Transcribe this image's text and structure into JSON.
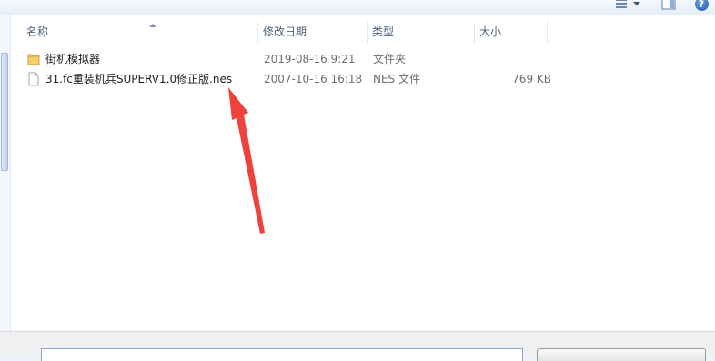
{
  "columns": {
    "name": "名称",
    "date": "修改日期",
    "type": "类型",
    "size": "大小"
  },
  "files": [
    {
      "icon": "folder-icon",
      "name": "街机模拟器",
      "date": "2019-08-16 9:21",
      "type": "文件夹",
      "size": ""
    },
    {
      "icon": "file-icon",
      "name": "31.fc重装机兵SUPERV1.0修正版.nes",
      "date": "2007-10-16 16:18",
      "type": "NES 文件",
      "size": "769 KB"
    }
  ],
  "toolbar": {
    "help_label": "?"
  },
  "colors": {
    "annotation_arrow": "#f0413c",
    "folder": "#e8b64a",
    "header_text": "#4c607a"
  }
}
